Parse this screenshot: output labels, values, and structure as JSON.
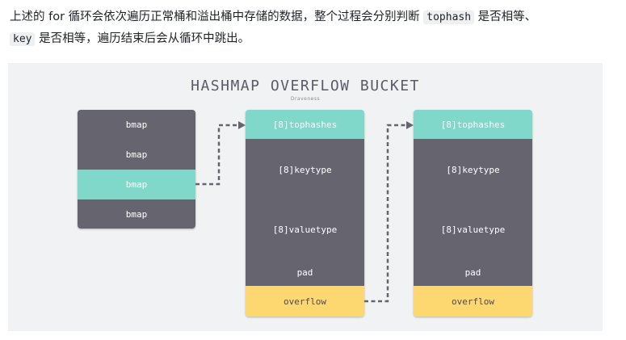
{
  "intro": {
    "part1": "上述的 for 循环会依次遍历正常桶和溢出桶中存储的数据，整个过程会分别判断 ",
    "code1": "tophash",
    "part2": " 是否相等、",
    "code2": "key",
    "part3": " 是否相等，遍历结束后会从循环中跳出。"
  },
  "diagram": {
    "title": "HASHMAP OVERFLOW BUCKET",
    "subtitle": "Draveness",
    "bmap_items": [
      "bmap",
      "bmap",
      "bmap",
      "bmap"
    ],
    "bucket1": {
      "tophashes": "[8]tophashes",
      "keytype": "[8]keytype",
      "valuetype": "[8]valuetype",
      "pad": "pad",
      "overflow": "overflow"
    },
    "bucket2": {
      "tophashes": "[8]tophashes",
      "keytype": "[8]keytype",
      "valuetype": "[8]valuetype",
      "pad": "pad",
      "overflow": "overflow"
    },
    "colors": {
      "dark": "#66656f",
      "teal": "#7fd8ca",
      "yellow": "#fdd770",
      "background": "#f1f2f3"
    }
  }
}
